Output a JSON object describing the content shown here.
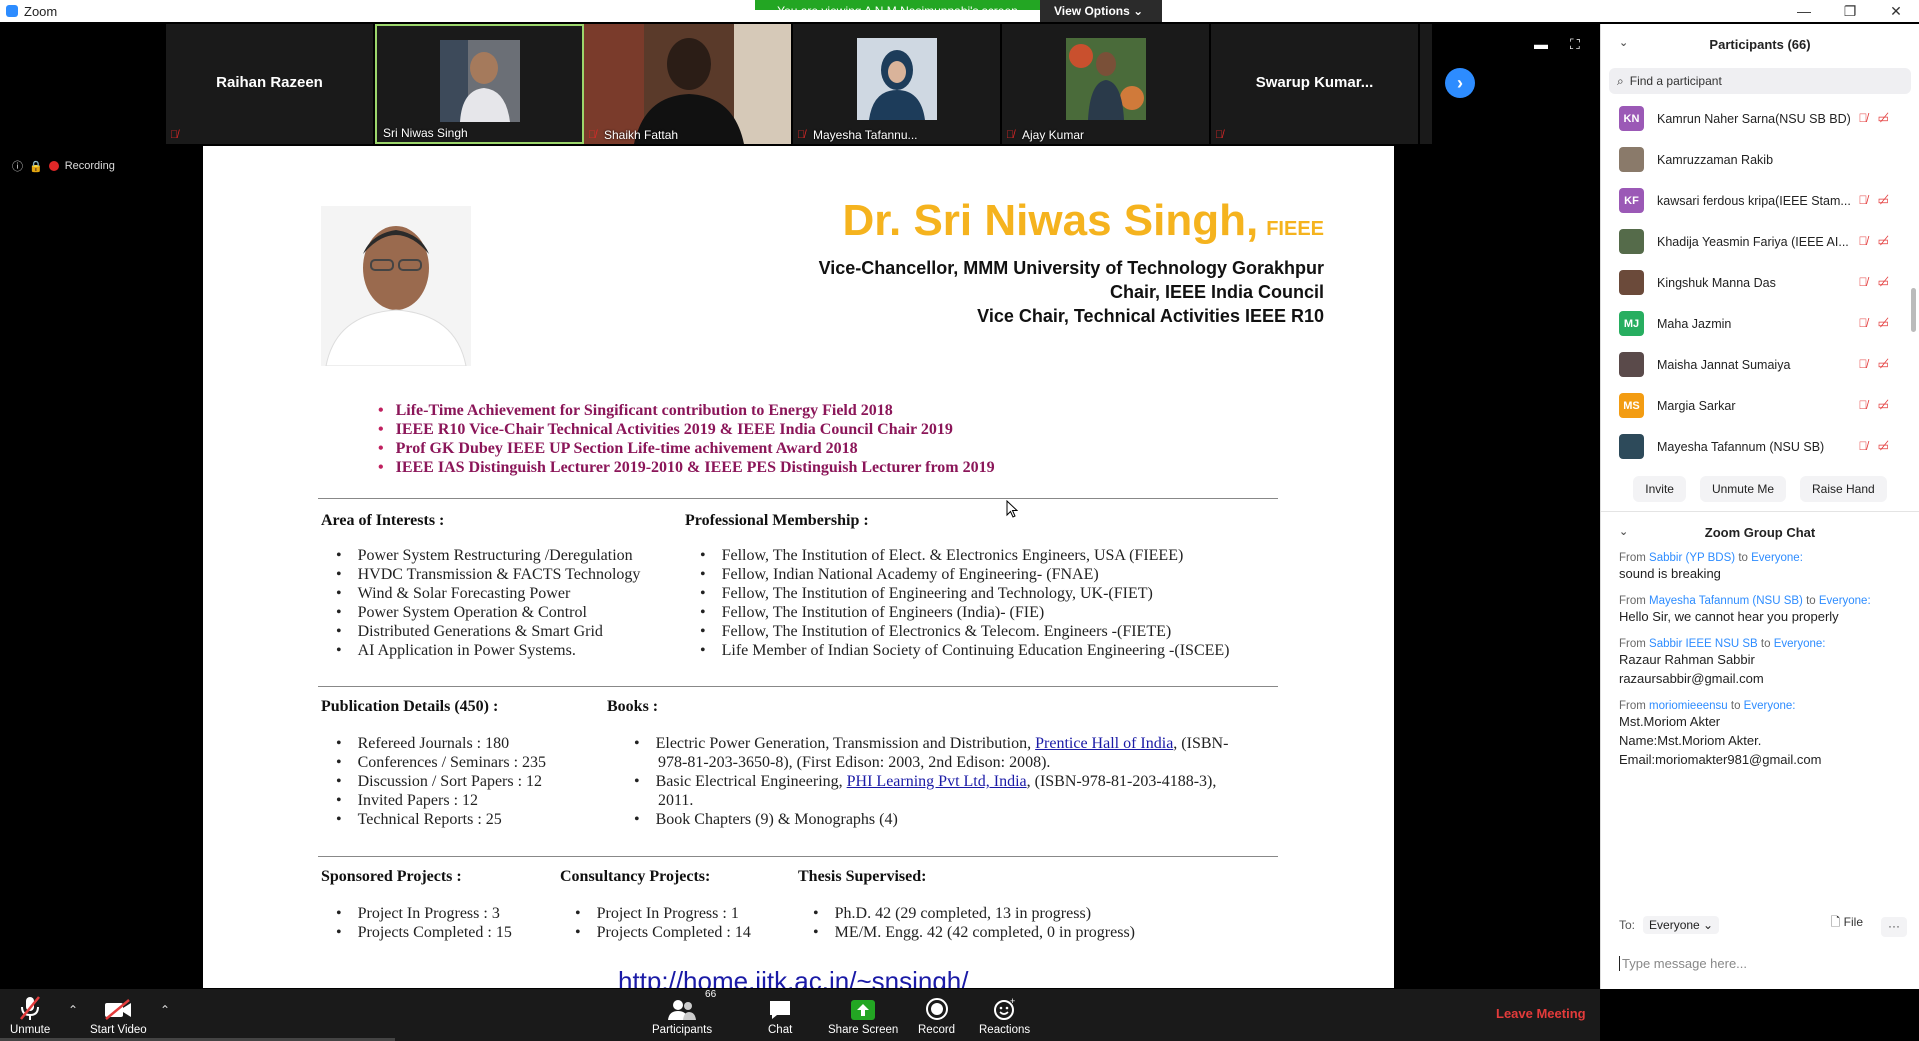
{
  "window": {
    "title": "Zoom",
    "minimize": "—",
    "maximize": "❐",
    "close": "✕"
  },
  "banner": {
    "message": "You are viewing A N M Nasimunnabi's screen",
    "view_options": "View Options ⌄"
  },
  "videos": [
    {
      "name": "Raihan Razeen",
      "type": "name"
    },
    {
      "name": "Sri Niwas Singh",
      "type": "photo",
      "active": true
    },
    {
      "name": "Shaikh Fattah",
      "type": "photo"
    },
    {
      "name": "Mayesha Tafannu...",
      "type": "photo"
    },
    {
      "name": "Ajay Kumar",
      "type": "photo"
    },
    {
      "name": "Swarup  Kumar...",
      "type": "name"
    }
  ],
  "recording": {
    "label": "Recording"
  },
  "slide": {
    "name": "Dr. Sri Niwas Singh,",
    "name_suffix": "FIEEE",
    "roles": [
      "Vice-Chancellor, MMM University of Technology Gorakhpur",
      "Chair, IEEE India Council",
      "Vice Chair, Technical Activities IEEE R10"
    ],
    "awards": [
      "Life-Time Achievement for Singificant contribution to Energy Field 2018",
      "IEEE R10 Vice-Chair Technical Activities 2019 & IEEE India Council Chair 2019",
      "Prof GK Dubey IEEE UP Section Life-time achivement Award 2018",
      "IEEE IAS Distinguish Lecturer 2019-2010 & IEEE PES Distinguish Lecturer from 2019"
    ],
    "interests_title": "Area of Interests :",
    "interests": [
      "Power System Restructuring /Deregulation",
      "HVDC Transmission & FACTS Technology",
      "Wind & Solar Forecasting Power",
      "Power System Operation & Control",
      "Distributed Generations & Smart Grid",
      "AI Application in Power Systems."
    ],
    "membership_title": "Professional Membership :",
    "membership": [
      "Fellow, The Institution of Elect. & Electronics Engineers, USA (FIEEE)",
      "Fellow, Indian National Academy of Engineering- (FNAE)",
      "Fellow, The Institution of Engineering and Technology, UK-(FIET)",
      "Fellow, The Institution of Engineers (India)- (FIE)",
      "Fellow, The Institution of Electronics & Telecom. Engineers -(FIETE)",
      "Life Member of Indian Society of Continuing Education Engineering -(ISCEE)"
    ],
    "publications_title": "Publication Details (450) :",
    "publications": [
      "Refereed Journals : 180",
      "Conferences / Seminars : 235",
      "Discussion / Sort Papers : 12",
      "Invited Papers : 12",
      "Technical Reports : 25"
    ],
    "books_title": "Books :",
    "book1_pre": "Electric Power Generation, Transmission and Distribution, ",
    "book1_link": "Prentice Hall of India",
    "book1_post": ", (ISBN-",
    "book1_cont": "978-81-203-3650-8), (First Edison: 2003, 2nd Edison: 2008).",
    "book2_pre": "Basic Electrical Engineering, ",
    "book2_link": "PHI Learning Pvt Ltd, India",
    "book2_post": ", (ISBN-978-81-203-4188-3),",
    "book2_cont": "2011.",
    "book3": "Book Chapters (9) & Monographs (4)",
    "sponsored_title": "Sponsored Projects :",
    "sponsored": [
      "Project In Progress : 3",
      "Projects Completed : 15"
    ],
    "consultancy_title": "Consultancy Projects:",
    "consultancy": [
      "Project In Progress : 1",
      "Projects Completed : 14"
    ],
    "thesis_title": "Thesis Supervised:",
    "thesis": [
      "Ph.D. 42 (29 completed, 13 in progress)",
      "ME/M. Engg. 42 (42 completed, 0 in progress)"
    ],
    "url": "http://home.iitk.ac.in/~snsingh/"
  },
  "participants": {
    "title": "Participants (66)",
    "search_placeholder": "Find a participant",
    "list": [
      {
        "initials": "KN",
        "color": "#9b59b6",
        "name": "Kamrun Naher Sarna(NSU SB BD)"
      },
      {
        "initials": "",
        "color": "#8a7a6a",
        "name": "Kamruzzaman Rakib"
      },
      {
        "initials": "KF",
        "color": "#9b59b6",
        "name": "kawsari ferdous kripa(IEEE Stam..."
      },
      {
        "initials": "",
        "color": "#556b4a",
        "name": "Khadija Yeasmin Fariya (IEEE AI..."
      },
      {
        "initials": "",
        "color": "#6b4a3a",
        "name": "Kingshuk Manna Das"
      },
      {
        "initials": "MJ",
        "color": "#27ae60",
        "name": "Maha Jazmin"
      },
      {
        "initials": "",
        "color": "#5a4a4a",
        "name": "Maisha Jannat Sumaiya"
      },
      {
        "initials": "MS",
        "color": "#f39c12",
        "name": "Margia Sarkar"
      },
      {
        "initials": "",
        "color": "#2d4a5a",
        "name": "Mayesha Tafannum (NSU SB)"
      }
    ],
    "invite": "Invite",
    "unmute_me": "Unmute Me",
    "raise_hand": "Raise Hand"
  },
  "chat": {
    "title": "Zoom Group Chat",
    "messages": [
      {
        "from": "Sabbir (YP BDS)",
        "to": "Everyone:",
        "text": "sound is breaking"
      },
      {
        "from": "Mayesha Tafannum (NSU SB)",
        "to": "Everyone:",
        "text": "Hello Sir, we cannot hear you properly"
      },
      {
        "from": "Sabbir IEEE NSU SB",
        "to": "Everyone:",
        "text": "Razaur Rahman Sabbir\nrazaursabbir@gmail.com"
      },
      {
        "from": "moriomieeensu",
        "to": "Everyone:",
        "text": "Mst.Moriom Akter\nName:Mst.Moriom Akter.\nEmail:moriomakter981@gmail.com"
      }
    ],
    "from_word": "From",
    "to_word": "to",
    "to_label": "To:",
    "to_value": "Everyone ⌄",
    "file_label": "File",
    "more_label": "···",
    "input_placeholder": "Type message here..."
  },
  "toolbar": {
    "unmute": "Unmute",
    "start_video": "Start Video",
    "participants": "Participants",
    "participants_count": "66",
    "chat": "Chat",
    "share_screen": "Share Screen",
    "record": "Record",
    "reactions": "Reactions",
    "leave": "Leave Meeting"
  }
}
